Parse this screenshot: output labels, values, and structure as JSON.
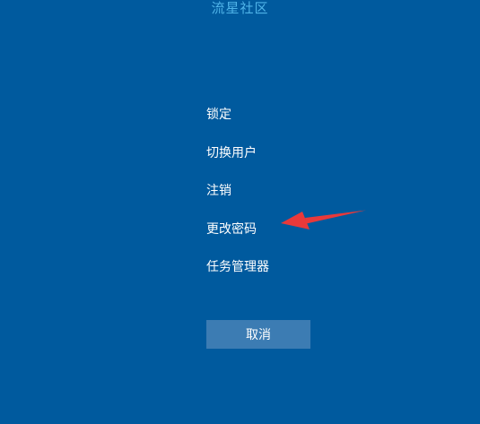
{
  "watermark": {
    "text": "流星社区"
  },
  "menu": {
    "items": [
      {
        "id": "lock",
        "label": "锁定"
      },
      {
        "id": "switch-user",
        "label": "切换用户"
      },
      {
        "id": "sign-out",
        "label": "注销"
      },
      {
        "id": "change-password",
        "label": "更改密码"
      },
      {
        "id": "task-manager",
        "label": "任务管理器"
      }
    ]
  },
  "cancel": {
    "label": "取消"
  },
  "colors": {
    "background": "#005a9e",
    "button": "#3c7cb3",
    "arrow": "#e8393a",
    "watermark": "#4fb3e8"
  },
  "annotation": {
    "icon": "red-arrow-icon",
    "points_to": "change-password"
  }
}
